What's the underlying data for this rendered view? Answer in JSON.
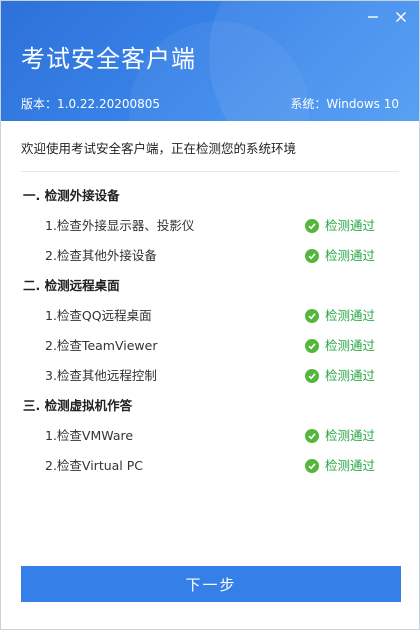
{
  "window": {
    "title": "考试安全客户端",
    "version": "版本：1.0.22.20200805",
    "os": "系统：Windows 10",
    "minimize_icon": "minimize-icon",
    "close_icon": "close-icon"
  },
  "intro": "欢迎使用考试安全客户端，正在检测您的系统环境",
  "sections": [
    {
      "title": "一. 检测外接设备",
      "items": [
        {
          "label": "1.检查外接显示器、投影仪",
          "status": "检测通过"
        },
        {
          "label": "2.检查其他外接设备",
          "status": "检测通过"
        }
      ]
    },
    {
      "title": "二. 检测远程桌面",
      "items": [
        {
          "label": "1.检查QQ远程桌面",
          "status": "检测通过"
        },
        {
          "label": "2.检查TeamViewer",
          "status": "检测通过"
        },
        {
          "label": "3.检查其他远程控制",
          "status": "检测通过"
        }
      ]
    },
    {
      "title": "三. 检测虚拟机作答",
      "items": [
        {
          "label": "1.检查VMWare",
          "status": "检测通过"
        },
        {
          "label": "2.检查Virtual PC",
          "status": "检测通过"
        }
      ]
    }
  ],
  "next_button": "下一步",
  "colors": {
    "header": "#3a86ea",
    "primary_button": "#3580e8",
    "pass_green": "#55b63c",
    "pass_text": "#28a745"
  }
}
